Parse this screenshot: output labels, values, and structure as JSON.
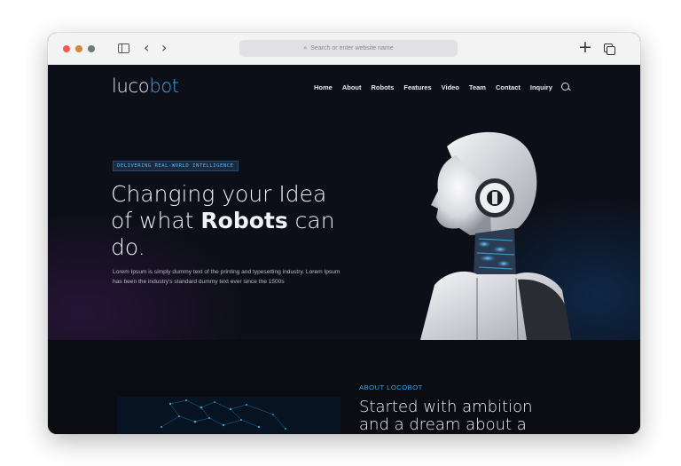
{
  "browser": {
    "url_placeholder": "Search or enter website name"
  },
  "site": {
    "logo": {
      "part1": "luco",
      "part2": "bot"
    },
    "nav": [
      "Home",
      "About",
      "Robots",
      "Features",
      "Video",
      "Team",
      "Contact",
      "Inquiry"
    ],
    "hero": {
      "tagline": "DELIVERING REAL-WORLD INTELLIGENCE",
      "headline_line1": "Changing your Idea",
      "headline_line2_pre": "of what ",
      "headline_line2_bold": "Robots",
      "headline_line2_post": " can",
      "headline_line3": "do.",
      "body": "Lorem Ipsum is simply dummy text of the printing and typesetting industry. Lorem Ipsum has been the industry's standard dummy text ever since the 1500s"
    },
    "about": {
      "kicker": "ABOUT LOCOBOT",
      "title_line1": "Started with ambition",
      "title_line2": "and a dream about a"
    }
  },
  "colors": {
    "accent": "#3ba3e8",
    "background": "#0d0f18"
  }
}
